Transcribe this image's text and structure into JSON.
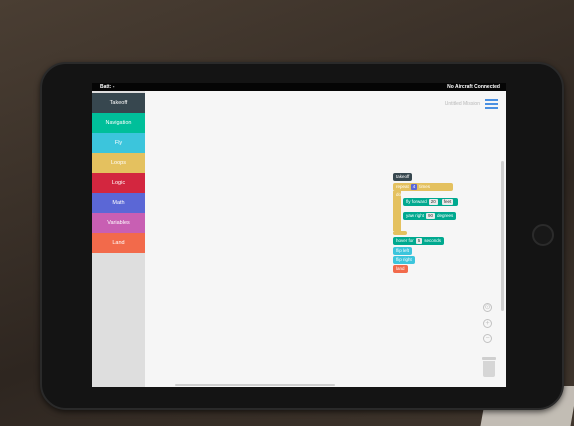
{
  "status": {
    "battery": "Batt: -",
    "connection": "No Aircraft Connected"
  },
  "sidebar": {
    "categories": [
      {
        "label": "Takeoff",
        "color": "#37474f"
      },
      {
        "label": "Navigation",
        "color": "#00bf9a"
      },
      {
        "label": "Fly",
        "color": "#3cc5dc"
      },
      {
        "label": "Loops",
        "color": "#e4c15f"
      },
      {
        "label": "Logic",
        "color": "#d3263f"
      },
      {
        "label": "Math",
        "color": "#5b67d6"
      },
      {
        "label": "Variables",
        "color": "#c85fb3"
      },
      {
        "label": "Land",
        "color": "#f26a4b"
      }
    ]
  },
  "workspace": {
    "mission_name": "Untitled Mission",
    "blocks": {
      "takeoff": "takeoff",
      "repeat": {
        "label": "repeat",
        "count": "4",
        "suffix": "times",
        "do_label": "do"
      },
      "fly_forward": {
        "label": "fly forward",
        "value": "20",
        "unit": "feet"
      },
      "yaw_right": {
        "label": "yaw right",
        "value": "90",
        "unit": "degrees"
      },
      "hover": {
        "label": "hover for",
        "value": "5",
        "unit": "seconds"
      },
      "flip_left": "flip left",
      "flip_right": "flip right",
      "land": "land"
    },
    "zoom_controls": {
      "reset": "⊙",
      "zoom_in": "+",
      "zoom_out": "−"
    }
  }
}
